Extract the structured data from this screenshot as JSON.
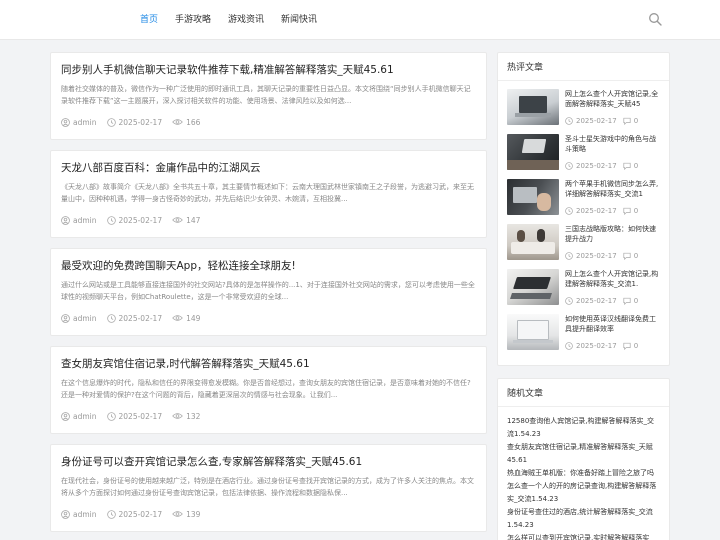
{
  "nav": {
    "items": [
      "首页",
      "手游攻略",
      "游戏资讯",
      "新闻快讯"
    ],
    "active": 0
  },
  "accent_color": "#1e88e5",
  "posts": [
    {
      "title": "同步别人手机微信聊天记录软件推荐下载,精准解答解释落实_天赋45.61",
      "excerpt": "随着社交媒体的普及，微信作为一种广泛使用的即时通讯工具，其聊天记录的重要性日益凸显。本文将围绕“同步别人手机微信聊天记录软件推荐下载”这一主题展开，深入探讨相关软件的功能、使用场景、法律风险以及如何选...",
      "author": "admin",
      "date": "2025-02-17",
      "views": "166"
    },
    {
      "title": "天龙八部百度百科：金庸作品中的江湖风云",
      "excerpt": "《天龙八部》故事简介《天龙八部》全书共五十章，其主要情节概述如下：云南大理国武林世家镇南王之子段誉，为逃避习武，来至无量山中，因种种机遇，学得一身古怪奇妙的武功，并先后结识少女钟灵、木婉清，互相投冀...",
      "author": "admin",
      "date": "2025-02-17",
      "views": "147"
    },
    {
      "title": "最受欢迎的免费跨国聊天App，轻松连接全球朋友!",
      "excerpt": "通过什么网站或是工具能够直接连接国外的社交网站?具体的是怎样操作的...1、对于连接国外社交网站的需求，您可以考虑使用一些全球性的视频聊天平台，例如ChatRoulette，这是一个非常受欢迎的全球...",
      "author": "admin",
      "date": "2025-02-17",
      "views": "149"
    },
    {
      "title": "查女朋友宾馆住宿记录,时代解答解释落实_天赋45.61",
      "excerpt": "在这个信息爆炸的时代，隐私和信任的界限变得愈发模糊。你是否曾经想过，查询女朋友的宾馆住宿记录，是否意味着对她的不信任?还是一种对爱情的保护?在这个问题的背后，隐藏着更深层次的情感与社会现象。让我们...",
      "author": "admin",
      "date": "2025-02-17",
      "views": "132"
    },
    {
      "title": "身份证号可以查开宾馆记录怎么查,专家解答解释落实_天赋45.61",
      "excerpt": "在现代社会，身份证号的使用越来越广泛，特别是在酒店行业。通过身份证号查找开宾馆记录的方式，成为了许多人关注的焦点。本文将从多个方面探讨如何通过身份证号查询宾馆记录，包括法律依据、操作流程和数据隐私保...",
      "author": "admin",
      "date": "2025-02-17",
      "views": "139"
    }
  ],
  "sidebar": {
    "hot_title": "热评文章",
    "hot_items": [
      {
        "title": "网上怎么查个人开宾馆记录,全面解答解释落实_天赋45",
        "date": "2025-02-17",
        "comments": "0",
        "thumb": "laptop-on-desk"
      },
      {
        "title": "圣斗士星矢游戏中的角色与战斗策略",
        "date": "2025-02-17",
        "comments": "0",
        "thumb": "dark-desk"
      },
      {
        "title": "两个苹果手机微信同步怎么弄,详细解答解释落实_交流1",
        "date": "2025-02-17",
        "comments": "0",
        "thumb": "person-typing"
      },
      {
        "title": "三国志战略版攻略：如何快速提升战力",
        "date": "2025-02-17",
        "comments": "0",
        "thumb": "meeting-table"
      },
      {
        "title": "网上怎么查个人开宾馆记录,构建解答解释落实_交流1.",
        "date": "2025-02-17",
        "comments": "0",
        "thumb": "keyboard-desk"
      },
      {
        "title": "如何使用英译汉线翻译免费工具提升翻译效率",
        "date": "2025-02-17",
        "comments": "0",
        "thumb": "white-laptop"
      }
    ],
    "random_title": "随机文章",
    "random_items": [
      "12580查询他人宾馆记录,构建解答解释落实_交流1.54.23",
      "查女朋友宾馆住宿记录,精准解答解释落实_天赋45.61",
      "热血海贼王单机版：你准备好踏上冒险之旅了吗",
      "怎么查一个人的开的房记录查询,构建解答解释落实_交流1.54.23",
      "身份证号查住过的酒店,统计解答解释落实_交流1.54.23",
      "怎么样可以查到开宾馆记录,实时解答解释落实_"
    ]
  }
}
